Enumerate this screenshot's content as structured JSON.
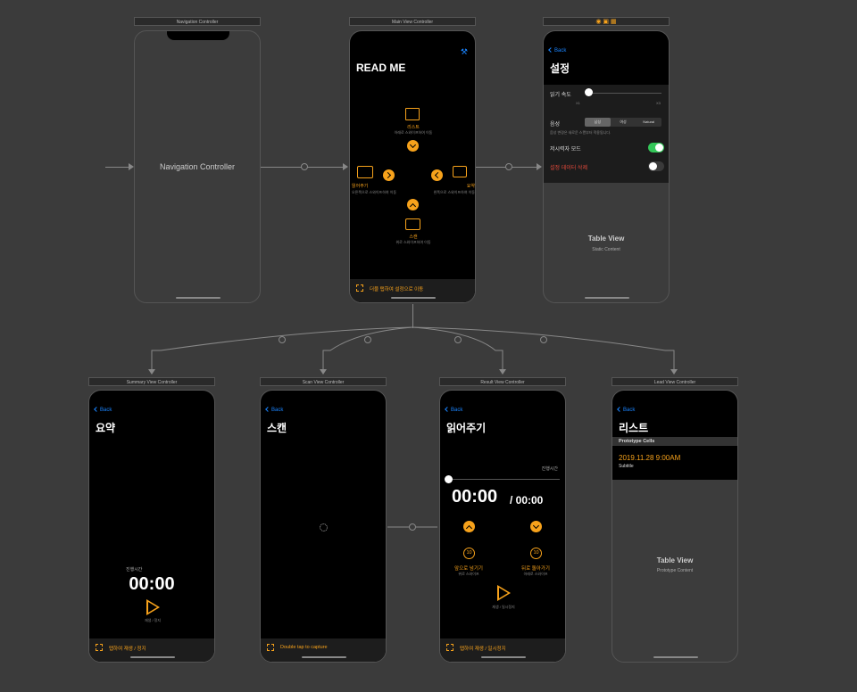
{
  "nav": {
    "title": "Navigation Controller",
    "label": "Navigation Controller"
  },
  "main": {
    "title": "Main View Controller",
    "heading": "READ ME",
    "list_label": "리스트",
    "list_sub": "아래로 스와이프하여 이동",
    "read_label": "읽어주기",
    "read_sub": "오른쪽으로 스와이프하여 이동",
    "summary_label": "요약",
    "summary_sub": "왼쪽으로 스와이프하여 이동",
    "scan_label": "스캔",
    "scan_sub": "위로 스와이프하여 이동",
    "bottom": "더블 탭하여 설정으로 이동"
  },
  "settings": {
    "back": "Back",
    "heading": "설정",
    "speed_label": "읽기 속도",
    "speed_min": "X1",
    "speed_max": "X3",
    "voice_label": "음성",
    "voice_options": [
      "남성",
      "여성",
      "Natural"
    ],
    "voice_note": "음성 변경은 새로운 스캔부터 적용됩니다.",
    "vision_label": "저시력자 모드",
    "delete_label": "설정 데이터 삭제",
    "table_title": "Table View",
    "table_sub": "Static Content"
  },
  "summary": {
    "title": "Summary View Controller",
    "back": "Back",
    "heading": "요약",
    "elapsed": "진행시간",
    "time": "00:00",
    "play_hint": "재생 / 정지",
    "bottom": "탭하여 재생 / 정지"
  },
  "scan": {
    "title": "Scan View Controller",
    "back": "Back",
    "heading": "스캔",
    "bottom": "Double tap to capture"
  },
  "result": {
    "title": "Result View Controller",
    "back": "Back",
    "heading": "읽어주기",
    "elapsed": "진행시간",
    "time": "00:00",
    "total": "/ 00:00",
    "fwd_label": "앞으로 넘기기",
    "fwd_sub": "위로 스와이프",
    "back_label": "뒤로 돌아가기",
    "back_sub": "아래로 스와이프",
    "skip_value": "10",
    "play_hint": "재생 / 일시정지",
    "bottom": "탭하여 재생 / 일시정지"
  },
  "list": {
    "title": "Lead View Controller",
    "back": "Back",
    "heading": "리스트",
    "section": "Prototype Cells",
    "cell_title": "2019.11.28 9:00AM",
    "cell_sub": "Subtitle",
    "table_title": "Table View",
    "table_sub": "Prototype Content"
  }
}
